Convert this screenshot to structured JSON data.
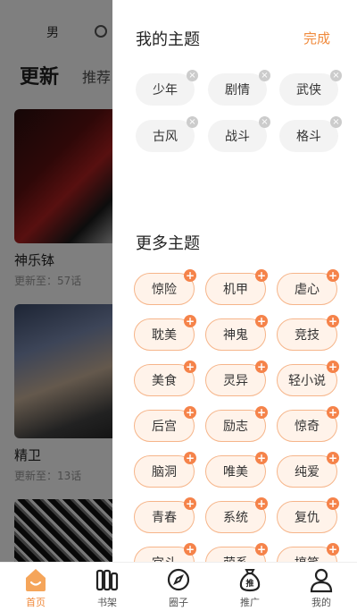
{
  "background": {
    "gender_tab": "男",
    "tabs": {
      "update": "更新",
      "recommend": "推荐"
    },
    "comics": [
      {
        "title": "神乐钵",
        "subtitle": "更新至：57话"
      },
      {
        "title": "精卫",
        "subtitle": "更新至：13话"
      }
    ]
  },
  "drawer": {
    "title": "我的主题",
    "done_label": "完成",
    "my_themes": [
      "少年",
      "剧情",
      "武侠",
      "古风",
      "战斗",
      "格斗"
    ],
    "more_title": "更多主题",
    "more_themes": [
      "惊险",
      "机甲",
      "虐心",
      "耽美",
      "神鬼",
      "竞技",
      "美食",
      "灵异",
      "轻小说",
      "后宫",
      "励志",
      "惊奇",
      "脑洞",
      "唯美",
      "纯爱",
      "青春",
      "系统",
      "复仇",
      "宫斗",
      "萌系",
      "搞笑"
    ]
  },
  "nav": {
    "items": [
      {
        "label": "首页",
        "icon": "home-icon",
        "active": true
      },
      {
        "label": "书架",
        "icon": "bookshelf-icon",
        "active": false
      },
      {
        "label": "圈子",
        "icon": "compass-icon",
        "active": false
      },
      {
        "label": "推广",
        "icon": "promote-bag-icon",
        "active": false
      },
      {
        "label": "我的",
        "icon": "profile-icon",
        "active": false
      }
    ]
  },
  "colors": {
    "accent": "#f08a3c",
    "tag_bg": "#fff3ea",
    "tag_border": "#f6b58a",
    "add_badge": "#f5834a"
  }
}
